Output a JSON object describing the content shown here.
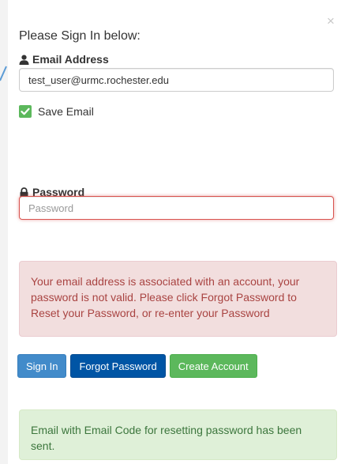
{
  "modal": {
    "close_symbol": "×",
    "title": "Please Sign In below:"
  },
  "email": {
    "label": "Email Address",
    "icon": "user-icon",
    "value": "test_user@urmc.rochester.edu",
    "save_label": "Save Email",
    "save_checked": true
  },
  "password": {
    "label": "Password",
    "icon": "lock-icon",
    "value": "",
    "placeholder": "Password"
  },
  "error_message": "Your email address is associated with an account, your password is not valid. Please click Forgot Password to Reset your Password, or re-enter your Password",
  "buttons": {
    "sign_in": "Sign In",
    "forgot_password": "Forgot Password",
    "create_account": "Create Account"
  },
  "success_message": "Email with Email Code for resetting password has been sent.",
  "colors": {
    "primary": "#428bca",
    "dark_primary": "#0055a5",
    "success": "#5cb85c",
    "danger_text": "#a94442",
    "danger_bg": "#f2dede",
    "success_text": "#3c763d",
    "success_bg": "#dff0d8"
  }
}
